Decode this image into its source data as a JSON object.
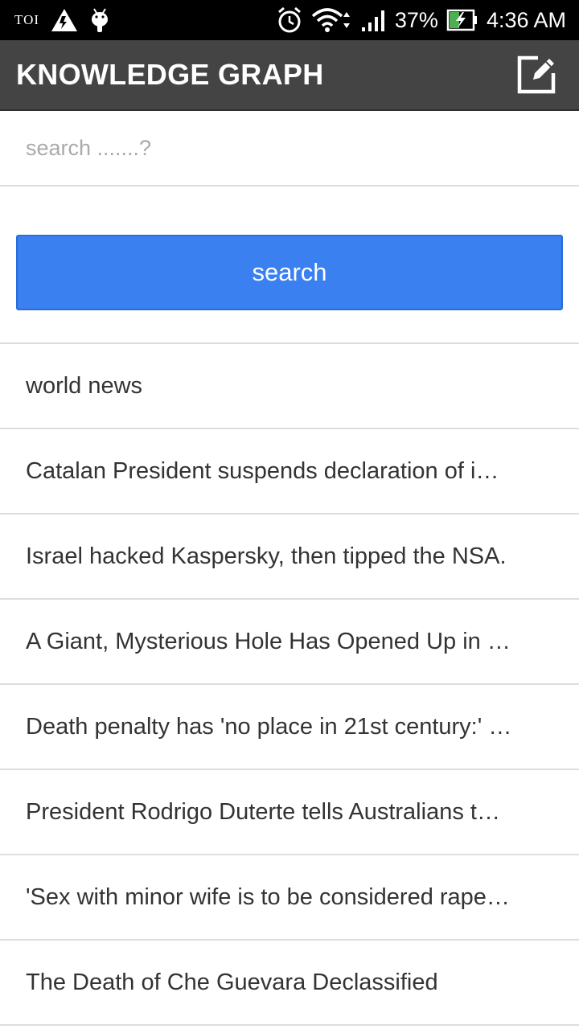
{
  "status_bar": {
    "carrier_label": "TOI",
    "battery_percent": "37%",
    "time": "4:36 AM",
    "icons": [
      "toi-icon",
      "warning-icon",
      "android-icon",
      "alarm-icon",
      "wifi-icon",
      "signal-icon",
      "battery-charging-icon"
    ]
  },
  "app_bar": {
    "title": "KNOWLEDGE GRAPH",
    "edit_icon": "edit-icon"
  },
  "search": {
    "placeholder": "search .......?",
    "value": "",
    "button_label": "search"
  },
  "list": {
    "items": [
      "world news",
      "Catalan President suspends declaration of i…",
      "Israel hacked Kaspersky, then tipped the NSA.",
      "A Giant, Mysterious Hole Has Opened Up in …",
      "Death penalty has 'no place in 21st century:' …",
      "President Rodrigo Duterte tells Australians t…",
      "'Sex with minor wife is to be considered rape…",
      "The Death of Che Guevara Declassified"
    ]
  },
  "colors": {
    "status_bar_bg": "#000000",
    "app_bar_bg": "#444444",
    "button_bg": "#3a80f0",
    "divider": "#dddddd"
  }
}
